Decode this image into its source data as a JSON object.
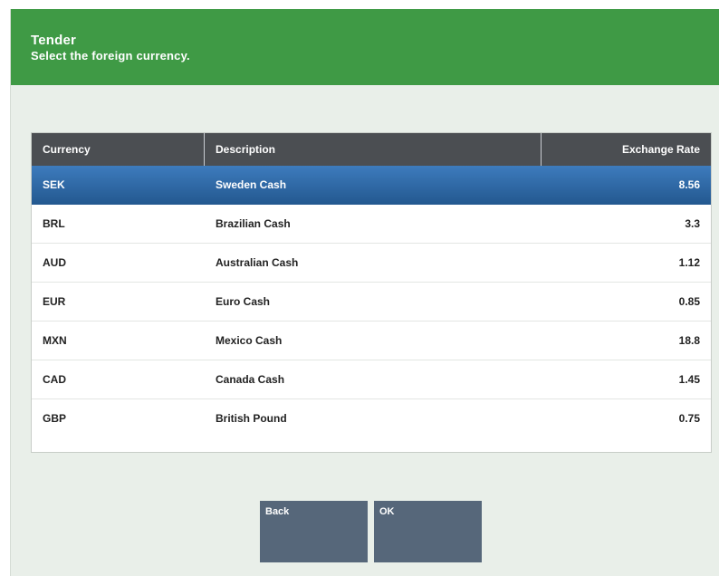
{
  "header": {
    "title": "Tender",
    "subtitle": "Select the foreign currency."
  },
  "table": {
    "columns": {
      "currency": "Currency",
      "description": "Description",
      "rate": "Exchange Rate"
    },
    "selected_index": 0,
    "rows": [
      {
        "currency": "SEK",
        "description": "Sweden Cash",
        "rate": "8.56"
      },
      {
        "currency": "BRL",
        "description": "Brazilian Cash",
        "rate": "3.3"
      },
      {
        "currency": "AUD",
        "description": "Australian Cash",
        "rate": "1.12"
      },
      {
        "currency": "EUR",
        "description": "Euro Cash",
        "rate": "0.85"
      },
      {
        "currency": "MXN",
        "description": "Mexico Cash",
        "rate": "18.8"
      },
      {
        "currency": "CAD",
        "description": "Canada Cash",
        "rate": "1.45"
      },
      {
        "currency": "GBP",
        "description": "British Pound",
        "rate": "0.75"
      }
    ]
  },
  "buttons": {
    "back_label": "Back",
    "ok_label": "OK"
  },
  "colors": {
    "header_bg": "#3f9a45",
    "table_header_bg": "#4b4e52",
    "selected_row": "#2f6aa8",
    "button_bg": "#56677a",
    "page_bg": "#e9efe9"
  }
}
